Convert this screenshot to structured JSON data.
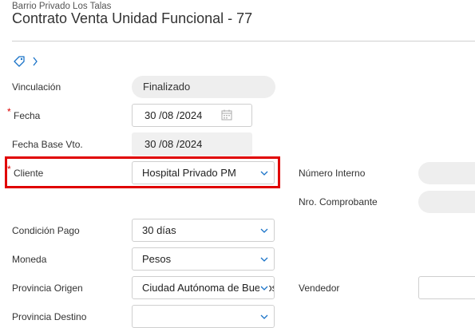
{
  "header": {
    "subtitle": "Barrio Privado Los Talas",
    "title": "Contrato Venta Unidad Funcional - 77"
  },
  "form": {
    "vinculacion": {
      "label": "Vinculación",
      "value": "Finalizado"
    },
    "fecha": {
      "label": "Fecha",
      "required_mark": "*",
      "day": "30",
      "month": "08",
      "year": "2024",
      "sep": "/"
    },
    "fecha_base": {
      "label": "Fecha Base Vto.",
      "day": "30",
      "month": "08",
      "year": "2024",
      "sep": "/"
    },
    "cliente": {
      "label": "Cliente",
      "required_mark": "*",
      "value": "Hospital Privado PM"
    },
    "numero_interno": {
      "label": "Número Interno",
      "value": ""
    },
    "nro_comprobante": {
      "label": "Nro. Comprobante",
      "value": ""
    },
    "condicion_pago": {
      "label": "Condición Pago",
      "value": "30 días"
    },
    "moneda": {
      "label": "Moneda",
      "value": "Pesos"
    },
    "provincia_origen": {
      "label": "Provincia Origen",
      "value": "Ciudad Autónoma de Buenos Aires"
    },
    "vendedor": {
      "label": "Vendedor",
      "value": ""
    },
    "provincia_destino": {
      "label": "Provincia Destino",
      "value": ""
    }
  },
  "colors": {
    "accent": "#1a73c8",
    "highlight": "#e00000",
    "required": "#dd0000"
  }
}
